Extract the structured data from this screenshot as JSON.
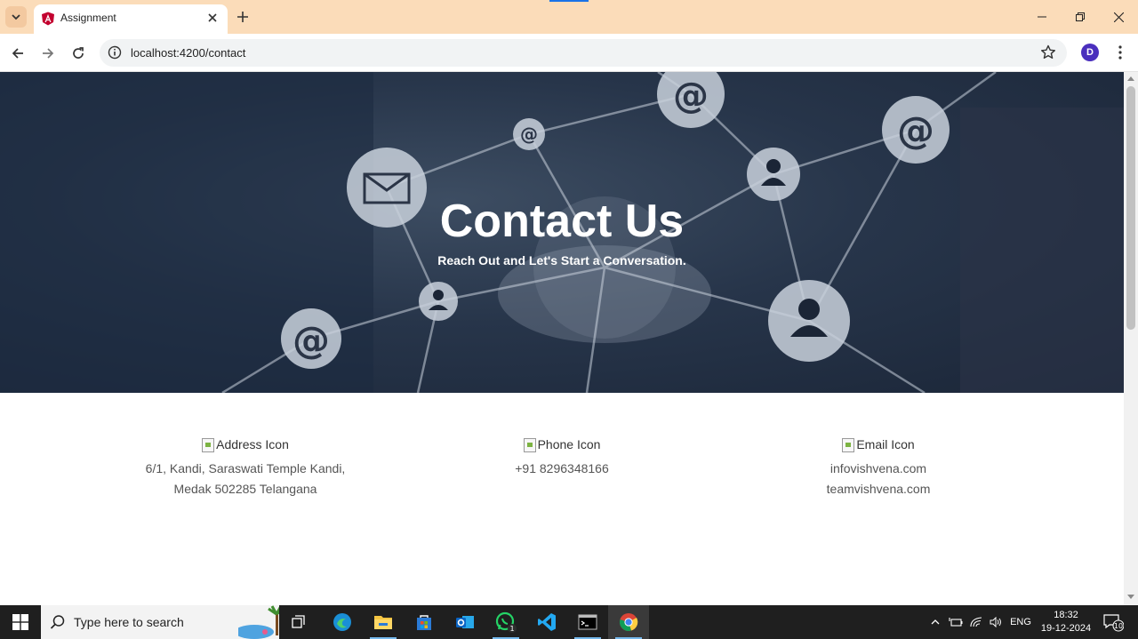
{
  "browser": {
    "tab_title": "Assignment",
    "url": "localhost:4200/contact",
    "profile_initial": "D"
  },
  "hero": {
    "title": "Contact Us",
    "subtitle": "Reach Out and Let's Start a Conversation."
  },
  "contacts": [
    {
      "icon_alt": "Address Icon",
      "lines": [
        "6/1, Kandi, Saraswati Temple Kandi,",
        "Medak 502285 Telangana"
      ]
    },
    {
      "icon_alt": "Phone Icon",
      "lines": [
        "+91 8296348166"
      ]
    },
    {
      "icon_alt": "Email Icon",
      "lines": [
        "infovishvena.com",
        "teamvishvena.com"
      ]
    }
  ],
  "taskbar": {
    "search_placeholder": "Type here to search",
    "language": "ENG",
    "time": "18:32",
    "date": "19-12-2024",
    "notification_count": "10",
    "whatsapp_badge": "1"
  },
  "colors": {
    "tabbar": "#fbdcb9",
    "accent": "#1a73e8",
    "profile": "#4a2fbd",
    "text_muted": "#555555"
  }
}
